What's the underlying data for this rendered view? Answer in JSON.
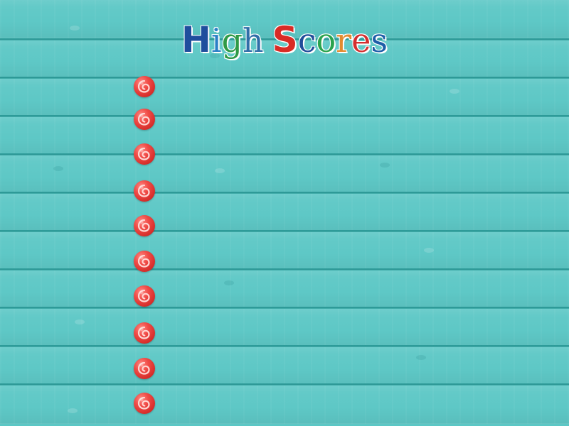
{
  "title": {
    "letters": [
      {
        "char": "H",
        "color": "#1f4e9d",
        "big": true
      },
      {
        "char": "i",
        "color": "#2a7fc6",
        "big": false
      },
      {
        "char": "g",
        "color": "#2f9a46",
        "big": false
      },
      {
        "char": "h",
        "color": "#2f6da8",
        "big": false
      },
      {
        "char": " ",
        "color": "#000000",
        "big": false,
        "space": true
      },
      {
        "char": "S",
        "color": "#d92b25",
        "big": true
      },
      {
        "char": "c",
        "color": "#214d9a",
        "big": false
      },
      {
        "char": "o",
        "color": "#2aa34d",
        "big": false
      },
      {
        "char": "r",
        "color": "#e38b2f",
        "big": false
      },
      {
        "char": "e",
        "color": "#d32f2f",
        "big": false
      },
      {
        "char": "s",
        "color": "#1d5ea8",
        "big": false
      }
    ]
  },
  "scores": [
    {
      "icon": "red-candy-icon",
      "rank": "",
      "name": "",
      "score": ""
    },
    {
      "icon": "red-candy-icon",
      "rank": "",
      "name": "",
      "score": ""
    },
    {
      "icon": "red-candy-icon",
      "rank": "",
      "name": "",
      "score": ""
    },
    {
      "icon": "red-candy-icon",
      "rank": "",
      "name": "",
      "score": ""
    },
    {
      "icon": "red-candy-icon",
      "rank": "",
      "name": "",
      "score": ""
    },
    {
      "icon": "red-candy-icon",
      "rank": "",
      "name": "",
      "score": ""
    },
    {
      "icon": "red-candy-icon",
      "rank": "",
      "name": "",
      "score": ""
    },
    {
      "icon": "red-candy-icon",
      "rank": "",
      "name": "",
      "score": ""
    },
    {
      "icon": "red-candy-icon",
      "rank": "",
      "name": "",
      "score": ""
    },
    {
      "icon": "red-candy-icon",
      "rank": "",
      "name": "",
      "score": ""
    }
  ],
  "theme": {
    "background": "#5cc7c5",
    "seam": "#2f9f9d",
    "candy": "#e23a35"
  }
}
